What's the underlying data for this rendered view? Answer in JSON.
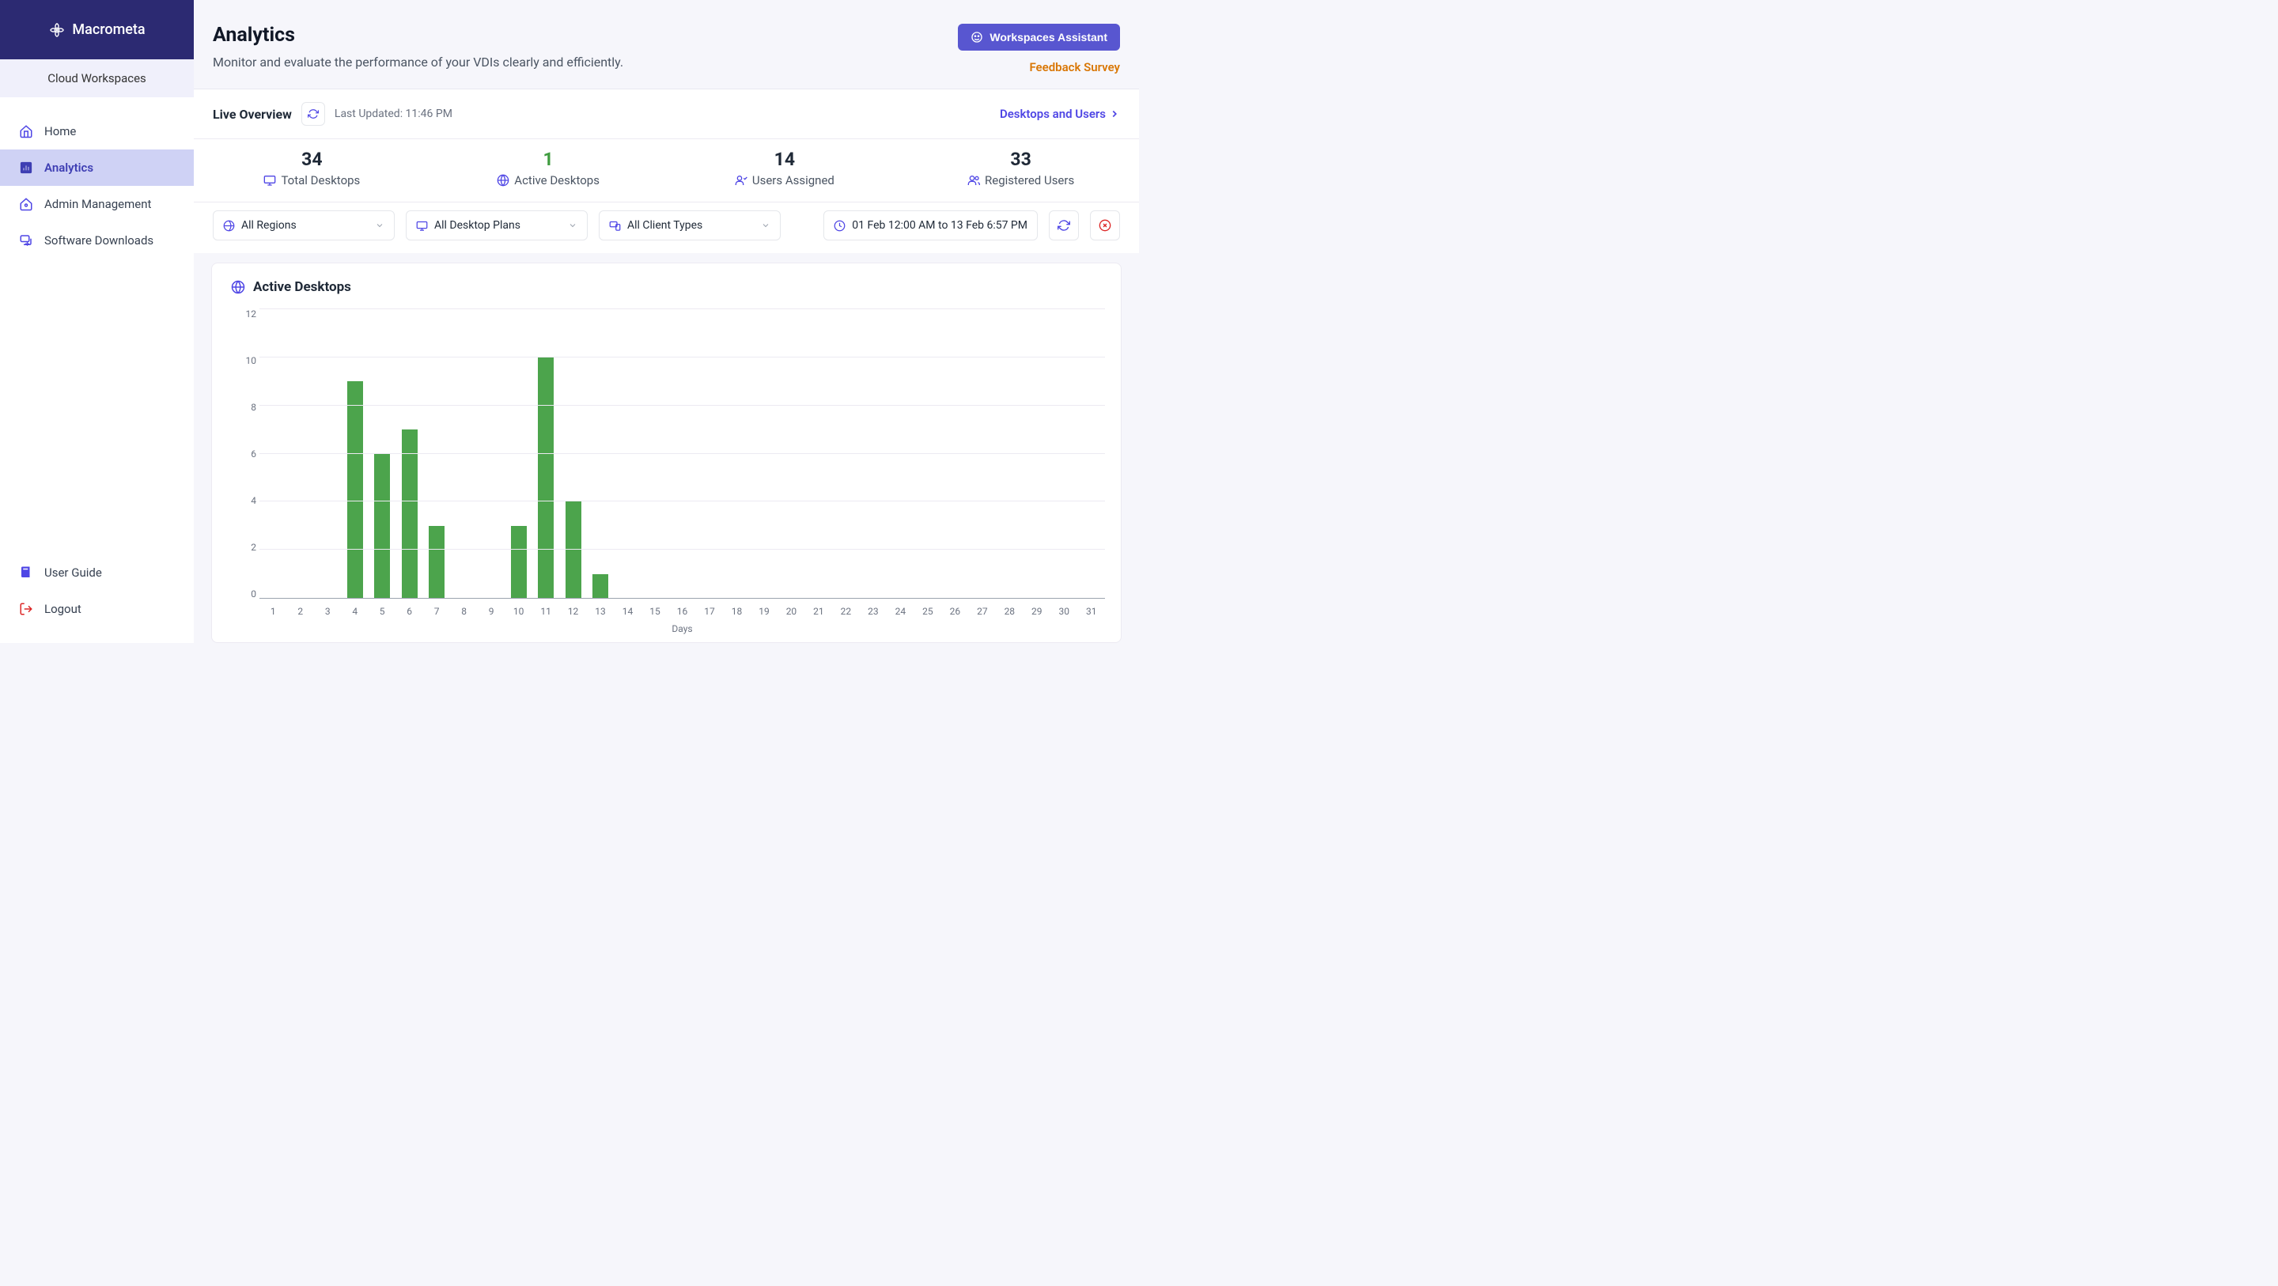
{
  "brand": {
    "name": "Macrometa"
  },
  "workspace": {
    "name": "Cloud Workspaces"
  },
  "sidebar": {
    "items": [
      {
        "label": "Home"
      },
      {
        "label": "Analytics"
      },
      {
        "label": "Admin Management"
      },
      {
        "label": "Software Downloads"
      }
    ],
    "bottom": [
      {
        "label": "User Guide"
      },
      {
        "label": "Logout"
      }
    ]
  },
  "header": {
    "title": "Analytics",
    "subtitle": "Monitor and evaluate the performance of your VDIs clearly and efficiently.",
    "assistant_button": "Workspaces Assistant",
    "feedback_link": "Feedback Survey"
  },
  "overview": {
    "title": "Live Overview",
    "last_updated": "Last Updated: 11:46 PM",
    "link": "Desktops and Users"
  },
  "stats": [
    {
      "value": "34",
      "label": "Total Desktops"
    },
    {
      "value": "1",
      "label": "Active Desktops",
      "highlight": true
    },
    {
      "value": "14",
      "label": "Users Assigned"
    },
    {
      "value": "33",
      "label": "Registered Users"
    }
  ],
  "filters": {
    "region": "All Regions",
    "plan": "All Desktop Plans",
    "client": "All Client Types",
    "date": "01 Feb 12:00 AM to 13 Feb 6:57 PM"
  },
  "chart": {
    "title": "Active Desktops",
    "xlabel": "Days"
  },
  "chart_data": {
    "type": "bar",
    "title": "Active Desktops",
    "xlabel": "Days",
    "ylabel": "",
    "ylim": [
      0,
      12
    ],
    "y_ticks": [
      0,
      2,
      4,
      6,
      8,
      10,
      12
    ],
    "categories": [
      "1",
      "2",
      "3",
      "4",
      "5",
      "6",
      "7",
      "8",
      "9",
      "10",
      "11",
      "12",
      "13",
      "14",
      "15",
      "16",
      "17",
      "18",
      "19",
      "20",
      "21",
      "22",
      "23",
      "24",
      "25",
      "26",
      "27",
      "28",
      "29",
      "30",
      "31"
    ],
    "values": [
      0,
      0,
      0,
      9,
      6,
      7,
      3,
      0,
      0,
      3,
      10,
      4,
      1,
      0,
      0,
      0,
      0,
      0,
      0,
      0,
      0,
      0,
      0,
      0,
      0,
      0,
      0,
      0,
      0,
      0,
      0
    ]
  }
}
